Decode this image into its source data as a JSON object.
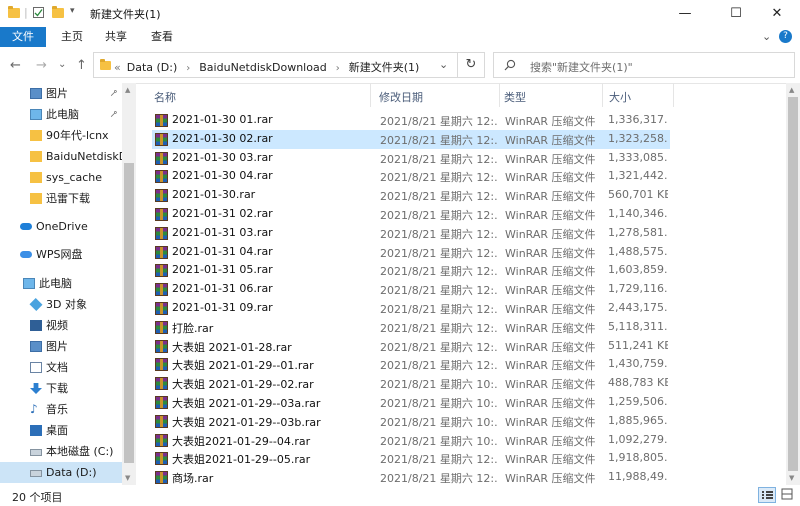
{
  "window": {
    "title": "新建文件夹(1)",
    "minimize": "—",
    "maximize": "☐",
    "close": "✕"
  },
  "ribbon": {
    "tabs": [
      "文件",
      "主页",
      "共享",
      "查看"
    ],
    "expand": "⌄",
    "help": "?"
  },
  "nav_buttons": {
    "back": "←",
    "forward": "→",
    "recent": "⌄",
    "up": "↑"
  },
  "address": {
    "prefix": "«",
    "crumbs": [
      "Data (D:)",
      "BaiduNetdiskDownload",
      "新建文件夹(1)"
    ],
    "separator": "›",
    "dropdown": "⌄",
    "refresh": "↻"
  },
  "search": {
    "placeholder": "搜索\"新建文件夹(1)\""
  },
  "nav_pane": {
    "items": [
      {
        "label": "图片",
        "icon": "pictures-icon",
        "pinned": true
      },
      {
        "label": "此电脑",
        "icon": "computer-icon",
        "pinned": true
      },
      {
        "label": "90年代-lcnx",
        "icon": "folder-icon"
      },
      {
        "label": "BaiduNetdiskDo",
        "icon": "folder-icon"
      },
      {
        "label": "sys_cache",
        "icon": "folder-icon"
      },
      {
        "label": "迅雷下载",
        "icon": "folder-icon"
      },
      {
        "label": "OneDrive",
        "icon": "onedrive-icon"
      },
      {
        "label": "WPS网盘",
        "icon": "wps-cloud-icon"
      },
      {
        "label": "此电脑",
        "icon": "computer-icon"
      },
      {
        "label": "3D 对象",
        "icon": "3d-objects-icon"
      },
      {
        "label": "视频",
        "icon": "videos-icon"
      },
      {
        "label": "图片",
        "icon": "pictures-icon"
      },
      {
        "label": "文档",
        "icon": "documents-icon"
      },
      {
        "label": "下载",
        "icon": "downloads-icon"
      },
      {
        "label": "音乐",
        "icon": "music-icon"
      },
      {
        "label": "桌面",
        "icon": "desktop-icon"
      },
      {
        "label": "本地磁盘 (C:)",
        "icon": "drive-c-icon"
      },
      {
        "label": "Data (D:)",
        "icon": "drive-d-icon",
        "selected": true
      }
    ],
    "pin_glyph": "📌"
  },
  "columns": [
    "名称",
    "修改日期",
    "类型",
    "大小"
  ],
  "files": [
    {
      "name": "2021-01-30 01.rar",
      "date": "2021/8/21 星期六 12:...",
      "type": "WinRAR 压缩文件",
      "size": "1,336,317..."
    },
    {
      "name": "2021-01-30 02.rar",
      "date": "2021/8/21 星期六 12:...",
      "type": "WinRAR 压缩文件",
      "size": "1,323,258...",
      "selected": true
    },
    {
      "name": "2021-01-30 03.rar",
      "date": "2021/8/21 星期六 12:...",
      "type": "WinRAR 压缩文件",
      "size": "1,333,085..."
    },
    {
      "name": "2021-01-30 04.rar",
      "date": "2021/8/21 星期六 12:...",
      "type": "WinRAR 压缩文件",
      "size": "1,321,442..."
    },
    {
      "name": "2021-01-30.rar",
      "date": "2021/8/21 星期六 12:...",
      "type": "WinRAR 压缩文件",
      "size": "560,701 KB"
    },
    {
      "name": "2021-01-31 02.rar",
      "date": "2021/8/21 星期六 12:...",
      "type": "WinRAR 压缩文件",
      "size": "1,140,346..."
    },
    {
      "name": "2021-01-31 03.rar",
      "date": "2021/8/21 星期六 12:...",
      "type": "WinRAR 压缩文件",
      "size": "1,278,581..."
    },
    {
      "name": "2021-01-31 04.rar",
      "date": "2021/8/21 星期六 12:...",
      "type": "WinRAR 压缩文件",
      "size": "1,488,575..."
    },
    {
      "name": "2021-01-31 05.rar",
      "date": "2021/8/21 星期六 12:...",
      "type": "WinRAR 压缩文件",
      "size": "1,603,859..."
    },
    {
      "name": "2021-01-31 06.rar",
      "date": "2021/8/21 星期六 12:...",
      "type": "WinRAR 压缩文件",
      "size": "1,729,116..."
    },
    {
      "name": "2021-01-31 09.rar",
      "date": "2021/8/21 星期六 12:...",
      "type": "WinRAR 压缩文件",
      "size": "2,443,175..."
    },
    {
      "name": "打脸.rar",
      "date": "2021/8/21 星期六 12:...",
      "type": "WinRAR 压缩文件",
      "size": "5,118,311..."
    },
    {
      "name": "大表姐 2021-01-28.rar",
      "date": "2021/8/21 星期六 12:...",
      "type": "WinRAR 压缩文件",
      "size": "511,241 KB"
    },
    {
      "name": "大表姐 2021-01-29--01.rar",
      "date": "2021/8/21 星期六 12:...",
      "type": "WinRAR 压缩文件",
      "size": "1,430,759..."
    },
    {
      "name": "大表姐 2021-01-29--02.rar",
      "date": "2021/8/21 星期六 10:...",
      "type": "WinRAR 压缩文件",
      "size": "488,783 KB"
    },
    {
      "name": "大表姐 2021-01-29--03a.rar",
      "date": "2021/8/21 星期六 10:...",
      "type": "WinRAR 压缩文件",
      "size": "1,259,506..."
    },
    {
      "name": "大表姐 2021-01-29--03b.rar",
      "date": "2021/8/21 星期六 10:...",
      "type": "WinRAR 压缩文件",
      "size": "1,885,965..."
    },
    {
      "name": "大表姐2021-01-29--04.rar",
      "date": "2021/8/21 星期六 10:...",
      "type": "WinRAR 压缩文件",
      "size": "1,092,279..."
    },
    {
      "name": "大表姐2021-01-29--05.rar",
      "date": "2021/8/21 星期六 12:...",
      "type": "WinRAR 压缩文件",
      "size": "1,918,805..."
    },
    {
      "name": "商场.rar",
      "date": "2021/8/21 星期六 12:...",
      "type": "WinRAR 压缩文件",
      "size": "11,988,49..."
    }
  ],
  "status": {
    "count": "20 个项目"
  },
  "colors": {
    "accent": "#1979ca",
    "selection": "#cce8ff",
    "header_text": "#4b5d7a"
  }
}
